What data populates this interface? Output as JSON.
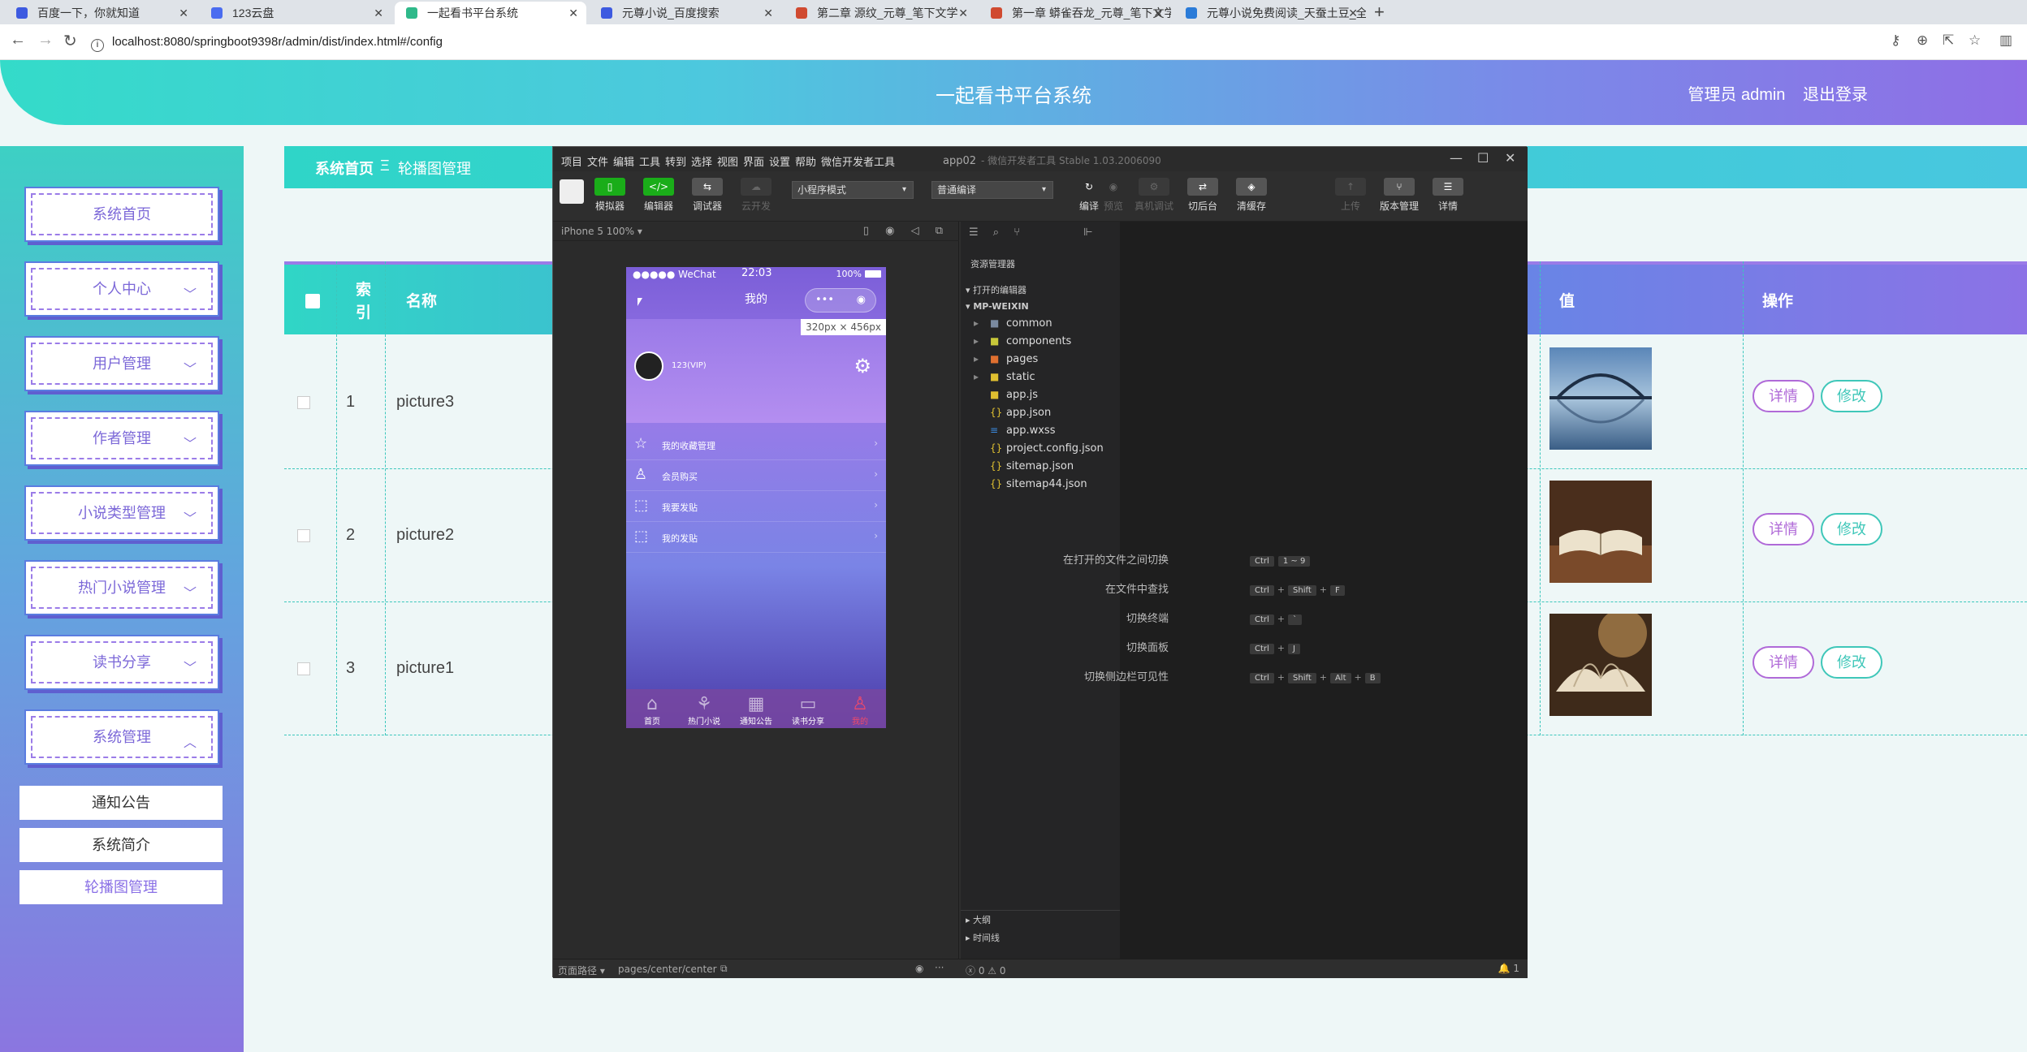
{
  "browser": {
    "tabs": [
      {
        "title": "百度一下，你就知道",
        "color": "#3d5ae0"
      },
      {
        "title": "123云盘",
        "color": "#4a6cf0"
      },
      {
        "title": "一起看书平台系统",
        "color": "#2fb98a"
      },
      {
        "title": "元尊小说_百度搜索",
        "color": "#3d5ae0"
      },
      {
        "title": "第二章 源纹_元尊_笔下文学",
        "color": "#d04a30"
      },
      {
        "title": "第一章 蟒雀吞龙_元尊_笔下文学",
        "color": "#d04a30"
      },
      {
        "title": "元尊小说免费阅读_天蚕土豆_全",
        "color": "#2a7bd8"
      }
    ],
    "url": "localhost:8080/springboot9398r/admin/dist/index.html#/config"
  },
  "app": {
    "title": "一起看书平台系统",
    "user_label": "管理员 admin",
    "logout_label": "退出登录"
  },
  "sidebar": {
    "items": [
      {
        "label": "系统首页",
        "chevron": ""
      },
      {
        "label": "个人中心",
        "chevron": "﹀"
      },
      {
        "label": "用户管理",
        "chevron": "﹀"
      },
      {
        "label": "作者管理",
        "chevron": "﹀"
      },
      {
        "label": "小说类型管理",
        "chevron": "﹀"
      },
      {
        "label": "热门小说管理",
        "chevron": "﹀"
      },
      {
        "label": "读书分享",
        "chevron": "﹀"
      },
      {
        "label": "系统管理",
        "chevron": "︿"
      }
    ],
    "subitems": [
      {
        "label": "通知公告"
      },
      {
        "label": "系统简介"
      },
      {
        "label": "轮播图管理"
      }
    ]
  },
  "breadcrumb": {
    "home": "系统首页",
    "sep": "Ξ",
    "current": "轮播图管理"
  },
  "table": {
    "headers": {
      "index": "索引",
      "name": "名称",
      "value": "值",
      "action": "操作"
    },
    "rows": [
      {
        "index": "1",
        "name": "picture3"
      },
      {
        "index": "2",
        "name": "picture2"
      },
      {
        "index": "3",
        "name": "picture1"
      }
    ],
    "detail_label": "详情",
    "edit_label": "修改"
  },
  "devtools": {
    "menu": [
      "项目",
      "文件",
      "编辑",
      "工具",
      "转到",
      "选择",
      "视图",
      "界面",
      "设置",
      "帮助",
      "微信开发者工具"
    ],
    "window_title": "app02",
    "window_subtitle": "- 微信开发者工具 Stable 1.03.2006090",
    "toolbar": [
      {
        "label": "模拟器",
        "glyph": "▯"
      },
      {
        "label": "编辑器",
        "glyph": "</>"
      },
      {
        "label": "调试器",
        "glyph": "⇆"
      },
      {
        "label": "云开发",
        "glyph": "☁"
      },
      {
        "label": "编译",
        "glyph": "↻"
      },
      {
        "label": "预览",
        "glyph": "◉"
      },
      {
        "label": "真机调试",
        "glyph": "⚙"
      },
      {
        "label": "切后台",
        "glyph": "⇄"
      },
      {
        "label": "清缓存",
        "glyph": "◈"
      },
      {
        "label": "上传",
        "glyph": "↑"
      },
      {
        "label": "版本管理",
        "glyph": "⑂"
      },
      {
        "label": "详情",
        "glyph": "☰"
      }
    ],
    "mode_select": "小程序模式",
    "compile_select": "普通编译",
    "device_label": "iPhone 5 100% ▾",
    "phone": {
      "carrier": "●●●●● WeChat",
      "time": "22:03",
      "battery": "100%",
      "nav_title": "我的",
      "size_tip": "320px × 456px",
      "username": "123(VIP)",
      "menu_rows": [
        {
          "label": "我的收藏管理",
          "icon": "☆"
        },
        {
          "label": "会员购买",
          "icon": "♙"
        },
        {
          "label": "我要发贴",
          "icon": "⬚"
        },
        {
          "label": "我的发贴",
          "icon": "⬚"
        }
      ],
      "tabbar": [
        {
          "label": "首页",
          "icon": "⌂",
          "active": false
        },
        {
          "label": "热门小说",
          "icon": "⚘",
          "active": false
        },
        {
          "label": "通知公告",
          "icon": "▦",
          "active": false
        },
        {
          "label": "读书分享",
          "icon": "▭",
          "active": false
        },
        {
          "label": "我的",
          "icon": "♙",
          "active": true
        }
      ]
    },
    "explorer": {
      "title": "资源管理器",
      "open_editors": "打开的编辑器",
      "project": "MP-WEIXIN",
      "files": [
        {
          "name": "common",
          "type": "folder",
          "color": "#7a8aa0"
        },
        {
          "name": "components",
          "type": "folder",
          "color": "#c8c83a"
        },
        {
          "name": "pages",
          "type": "folder",
          "color": "#e07030"
        },
        {
          "name": "static",
          "type": "folder",
          "color": "#e0c030"
        },
        {
          "name": "app.js",
          "type": "file",
          "color": "#e0c030"
        },
        {
          "name": "app.json",
          "type": "file",
          "color": "#e0c030"
        },
        {
          "name": "app.wxss",
          "type": "file",
          "color": "#3a8ae0"
        },
        {
          "name": "project.config.json",
          "type": "file",
          "color": "#e0c030"
        },
        {
          "name": "sitemap.json",
          "type": "file",
          "color": "#e0c030"
        },
        {
          "name": "sitemap44.json",
          "type": "file",
          "color": "#e0c030"
        }
      ],
      "outline": "大纲",
      "timeline": "时间线"
    },
    "shortcuts": [
      {
        "label": "在打开的文件之间切换",
        "keys": [
          "Ctrl",
          "1 ~ 9"
        ]
      },
      {
        "label": "在文件中查找",
        "keys": [
          "Ctrl",
          "Shift",
          "F"
        ]
      },
      {
        "label": "切换终端",
        "keys": [
          "Ctrl",
          "`"
        ]
      },
      {
        "label": "切换面板",
        "keys": [
          "Ctrl",
          "J"
        ]
      },
      {
        "label": "切换侧边栏可见性",
        "keys": [
          "Ctrl",
          "Shift",
          "Alt",
          "B"
        ]
      }
    ],
    "status": {
      "path_label": "页面路径 ▾",
      "path": "pages/center/center",
      "errors": "ⓧ 0 ⚠ 0",
      "notify": "🔔 1"
    }
  }
}
